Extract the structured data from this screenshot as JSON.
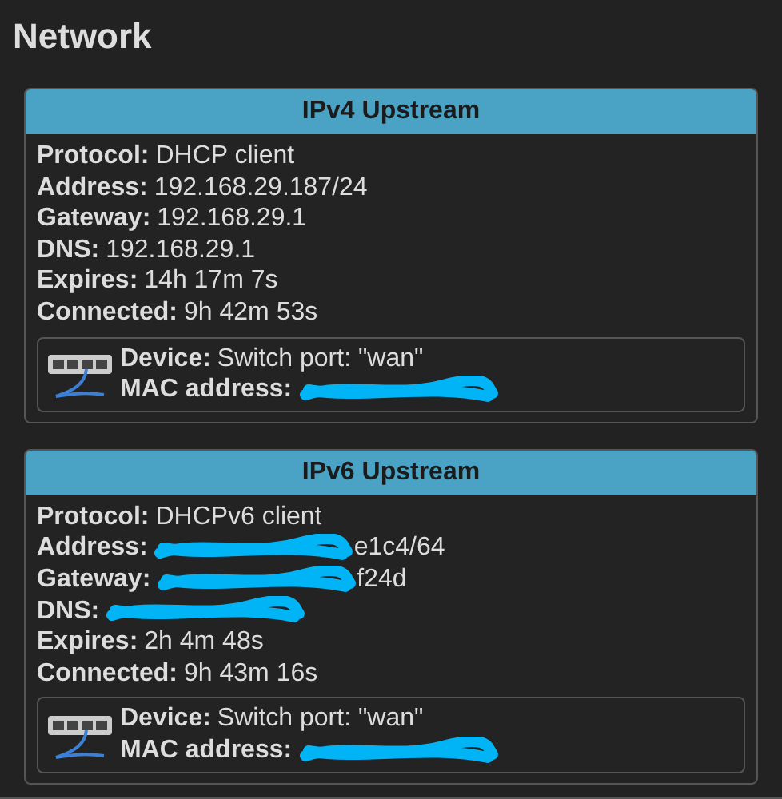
{
  "title": "Network",
  "panels": [
    {
      "title": "IPv4 Upstream",
      "fields": [
        {
          "label": "Protocol:",
          "value": "DHCP client",
          "redacted": false
        },
        {
          "label": "Address:",
          "value": "192.168.29.187/24",
          "redacted": false
        },
        {
          "label": "Gateway:",
          "value": "192.168.29.1",
          "redacted": false
        },
        {
          "label": "DNS:",
          "value": "192.168.29.1",
          "redacted": false
        },
        {
          "label": "Expires:",
          "value": "14h 17m 7s",
          "redacted": false
        },
        {
          "label": "Connected:",
          "value": "9h 42m 53s",
          "redacted": false
        }
      ],
      "device": {
        "fields": [
          {
            "label": "Device:",
            "value": "Switch port: \"wan\"",
            "redacted": false
          },
          {
            "label": "MAC address:",
            "redacted": true
          }
        ]
      }
    },
    {
      "title": "IPv6 Upstream",
      "fields": [
        {
          "label": "Protocol:",
          "value": "DHCPv6 client",
          "redacted": false
        },
        {
          "label": "Address:",
          "value": "e1c4/64",
          "redacted": true
        },
        {
          "label": "Gateway:",
          "value": "f24d",
          "redacted": true
        },
        {
          "label": "DNS:",
          "redacted": true
        },
        {
          "label": "Expires:",
          "value": "2h 4m 48s",
          "redacted": false
        },
        {
          "label": "Connected:",
          "value": "9h 43m 16s",
          "redacted": false
        }
      ],
      "device": {
        "fields": [
          {
            "label": "Device:",
            "value": "Switch port: \"wan\"",
            "redacted": false
          },
          {
            "label": "MAC address:",
            "redacted": true
          }
        ]
      }
    }
  ]
}
